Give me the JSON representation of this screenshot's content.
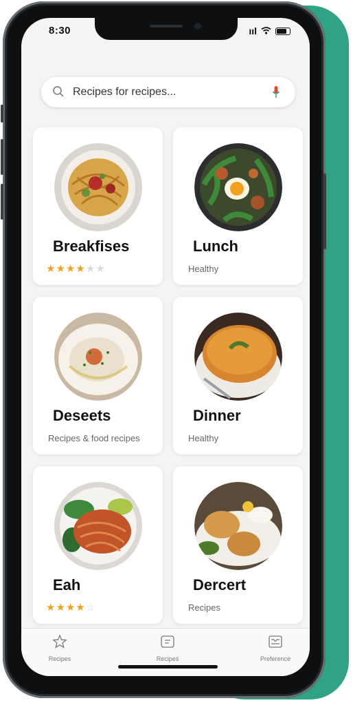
{
  "status_bar": {
    "time": "8:30",
    "signal": "ııl"
  },
  "search": {
    "placeholder": "Recipes for recipes..."
  },
  "categories": [
    {
      "title": "Breakfises",
      "rating": 3.5,
      "subtitle": ""
    },
    {
      "title": "Lunch",
      "subtitle": "Healthy"
    },
    {
      "title": "Deseets",
      "subtitle": "Recipes & food recipes"
    },
    {
      "title": "Dinner",
      "subtitle": "Healthy"
    },
    {
      "title": "Eah",
      "rating": 3.5,
      "subtitle": ""
    },
    {
      "title": "Dercert",
      "subtitle": "Recipes"
    }
  ],
  "tabs": [
    {
      "label": "Recipes",
      "icon": "star-icon"
    },
    {
      "label": "Recipes",
      "icon": "recipe-card-icon"
    },
    {
      "label": "Preference",
      "icon": "tray-icon"
    }
  ],
  "colors": {
    "accent": "#2fa384",
    "star": "#f0a020",
    "mic": "#e04b2f"
  }
}
